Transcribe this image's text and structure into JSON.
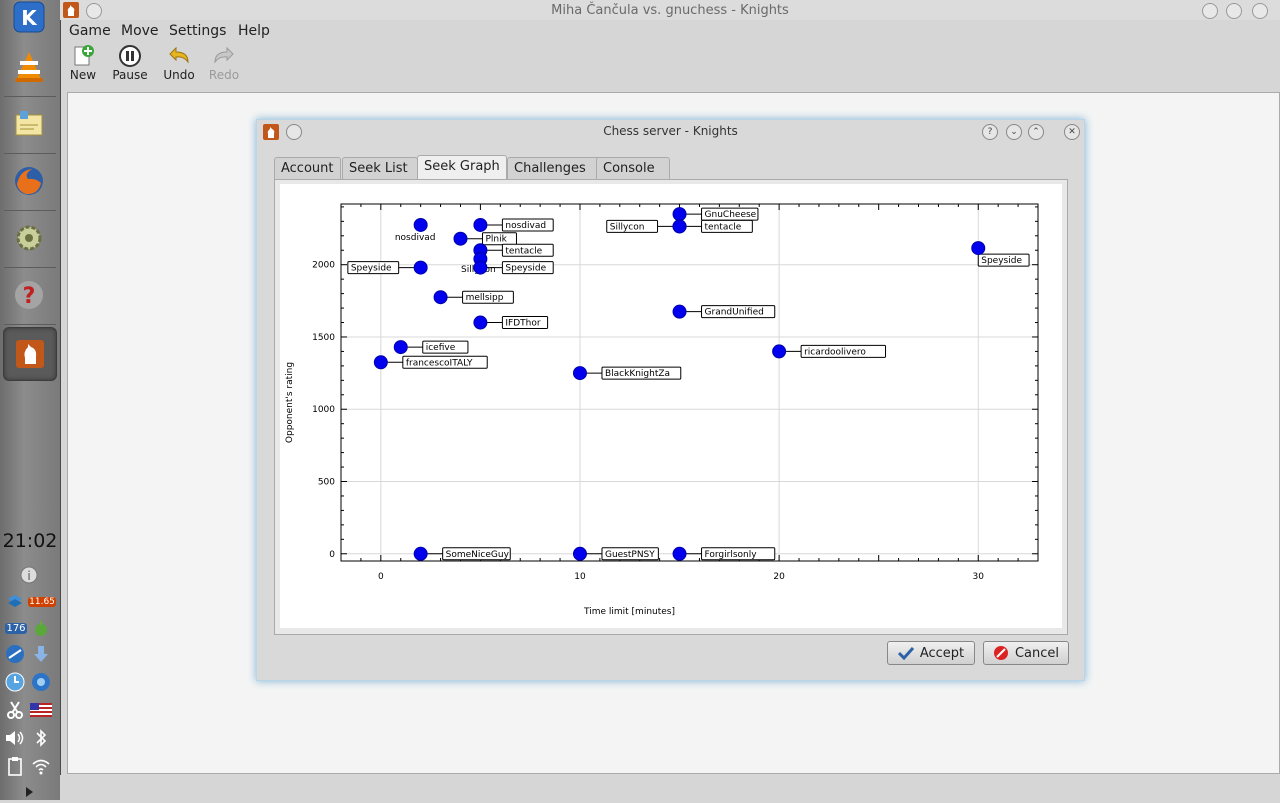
{
  "window": {
    "title": "Miha Čančula vs. gnuchess - Knights"
  },
  "menu": [
    {
      "label": "Game",
      "key": "G"
    },
    {
      "label": "Move",
      "key": "M"
    },
    {
      "label": "Settings",
      "key": "S"
    },
    {
      "label": "Help",
      "key": "H"
    }
  ],
  "toolbar": {
    "new": "New",
    "pause": "Pause",
    "undo": "Undo",
    "redo": "Redo"
  },
  "panel": {
    "clock": "21:02",
    "tray_badge_1": "11.65",
    "tray_badge_2": "176"
  },
  "dialog": {
    "title": "Chess server - Knights",
    "tabs": [
      "Account",
      "Seek List",
      "Seek Graph",
      "Challenges",
      "Console"
    ],
    "selected_tab": "Seek Graph",
    "accept": "Accept",
    "cancel": "Cancel"
  },
  "chart_data": {
    "type": "scatter",
    "title": "",
    "xlabel": "Time limit [minutes]",
    "ylabel": "Opponent's rating",
    "xlim": [
      -2,
      33
    ],
    "ylim": [
      -50,
      2420
    ],
    "xticks": [
      0,
      10,
      20,
      30
    ],
    "yticks": [
      0,
      500,
      1000,
      1500,
      2000
    ],
    "grid": true,
    "points": [
      {
        "x": 2,
        "y": 2275,
        "label": "nosdivad",
        "side": "below-left"
      },
      {
        "x": 5,
        "y": 2275,
        "label": "nosdivad",
        "side": "right"
      },
      {
        "x": 4,
        "y": 2180,
        "label": "Plnik",
        "side": "right"
      },
      {
        "x": 5,
        "y": 2100,
        "label": "tentacle",
        "side": "right"
      },
      {
        "x": 5,
        "y": 2040,
        "label": "Sillycon",
        "side": "below"
      },
      {
        "x": 5,
        "y": 1980,
        "label": "Speyside",
        "side": "right"
      },
      {
        "x": 2,
        "y": 1980,
        "label": "Speyside",
        "side": "left"
      },
      {
        "x": 3,
        "y": 1775,
        "label": "mellsipp",
        "side": "right"
      },
      {
        "x": 5,
        "y": 1600,
        "label": "IFDThor",
        "side": "right"
      },
      {
        "x": 1,
        "y": 1430,
        "label": "icefive",
        "side": "right"
      },
      {
        "x": 0,
        "y": 1325,
        "label": "francescoITALY",
        "side": "right"
      },
      {
        "x": 15,
        "y": 2350,
        "label": "GnuCheese",
        "side": "right"
      },
      {
        "x": 15,
        "y": 2265,
        "label": "Sillycon",
        "side": "left"
      },
      {
        "x": 15,
        "y": 2265,
        "label": "tentacle",
        "side": "right"
      },
      {
        "x": 15,
        "y": 1675,
        "label": "GrandUnified",
        "side": "right"
      },
      {
        "x": 10,
        "y": 1250,
        "label": "BlackKnightZa",
        "side": "right"
      },
      {
        "x": 20,
        "y": 1400,
        "label": "ricardoolivero",
        "side": "right"
      },
      {
        "x": 30,
        "y": 2115,
        "label": "Speyside",
        "side": "below-right"
      },
      {
        "x": 2,
        "y": 0,
        "label": "SomeNiceGuy",
        "side": "right"
      },
      {
        "x": 10,
        "y": 0,
        "label": "GuestPNSY",
        "side": "right"
      },
      {
        "x": 15,
        "y": 0,
        "label": "Forgirlsonly",
        "side": "right"
      }
    ]
  }
}
